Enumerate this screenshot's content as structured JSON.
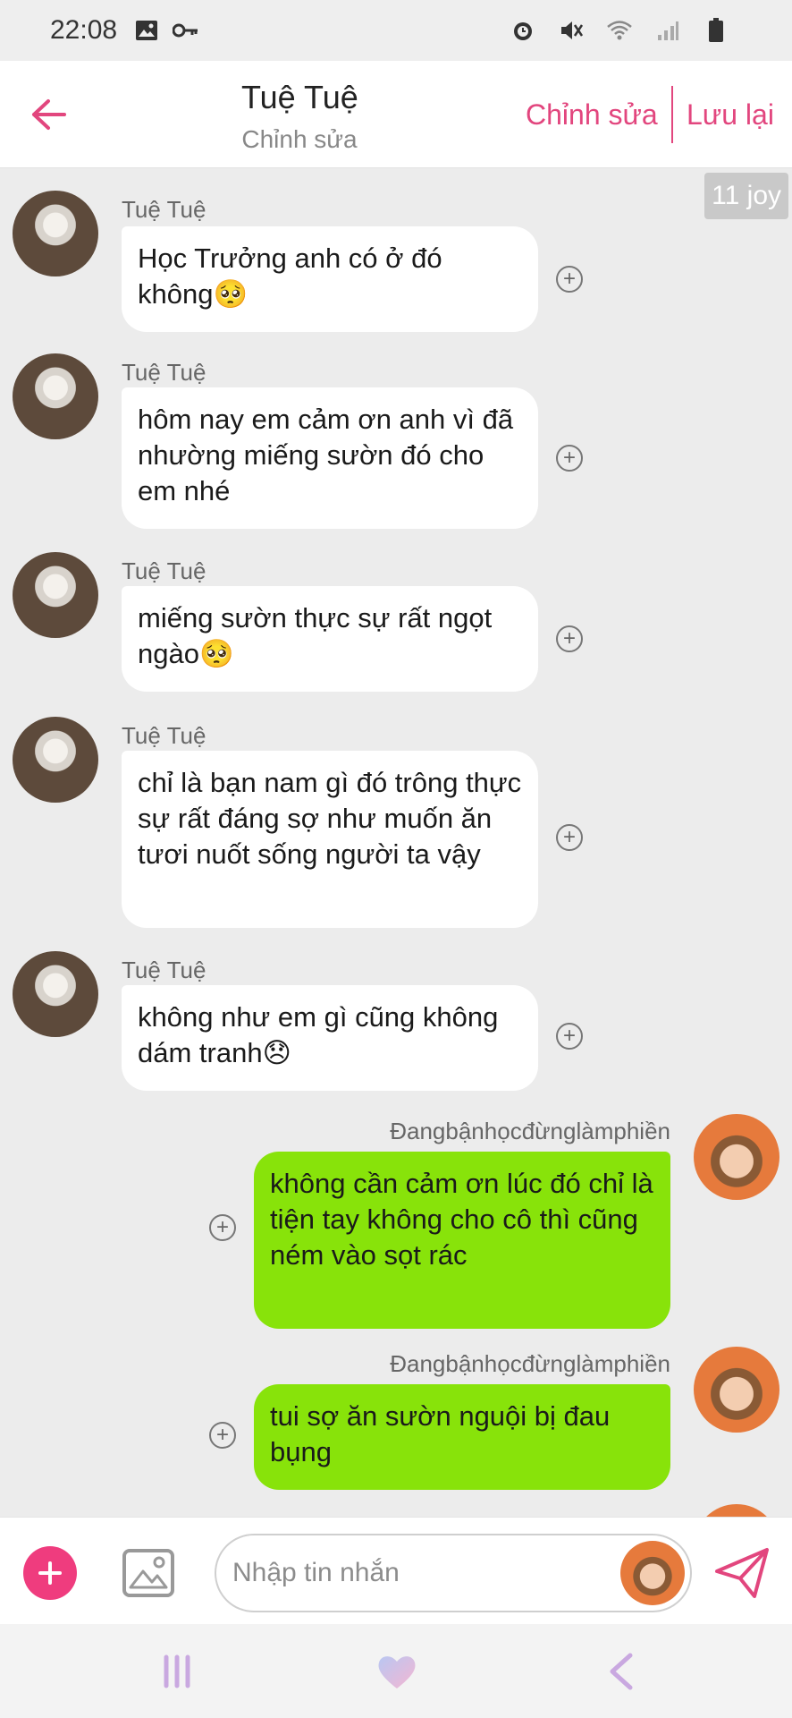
{
  "status_bar": {
    "time": "22:08",
    "left_icons": [
      "image-icon",
      "key-icon"
    ],
    "right_icons": [
      "alarm-icon",
      "mute-icon",
      "wifi-icon",
      "signal-icon",
      "battery-icon"
    ]
  },
  "header": {
    "title": "Tuệ Tuệ",
    "subtitle": "Chỉnh sửa",
    "edit_label": "Chỉnh sửa",
    "save_label": "Lưu lại",
    "accent_color": "#e2467e"
  },
  "badge": "11 joy",
  "messages": [
    {
      "direction": "in",
      "sender": "Tuệ Tuệ",
      "text": "Học Trưởng anh có ở đó không🥺"
    },
    {
      "direction": "in",
      "sender": "Tuệ Tuệ",
      "text": "hôm nay em cảm ơn anh vì đã nhường miếng sườn đó cho em nhé"
    },
    {
      "direction": "in",
      "sender": "Tuệ Tuệ",
      "text": "miếng sườn thực sự rất ngọt ngào🥺"
    },
    {
      "direction": "in",
      "sender": "Tuệ Tuệ",
      "text": "chỉ là bạn nam gì đó trông thực sự rất đáng sợ như muốn ăn tươi nuốt sống người ta vậy"
    },
    {
      "direction": "in",
      "sender": "Tuệ Tuệ",
      "text": "không như em gì cũng không dám tranh😞"
    },
    {
      "direction": "out",
      "sender": "Đangbậnhọcđừnglàmphiền",
      "text": "không cần cảm ơn lúc đó chỉ là tiện tay không cho cô thì cũng ném vào sọt rác"
    },
    {
      "direction": "out",
      "sender": "Đangbậnhọcđừnglàmphiền",
      "text": "tui sợ ăn sườn nguội bị đau bụng"
    }
  ],
  "colors": {
    "incoming_bubble": "#ffffff",
    "outgoing_bubble": "#88e30a",
    "chat_background": "#ececec",
    "add_button": "#ef3c7e"
  },
  "input_bar": {
    "placeholder": "Nhập tin nhắn",
    "add_icon": "plus-icon",
    "image_icon": "image-icon",
    "send_icon": "send-icon"
  },
  "nav_bar": {
    "icons": [
      "recent-apps-icon",
      "heart-home-icon",
      "back-icon"
    ]
  }
}
